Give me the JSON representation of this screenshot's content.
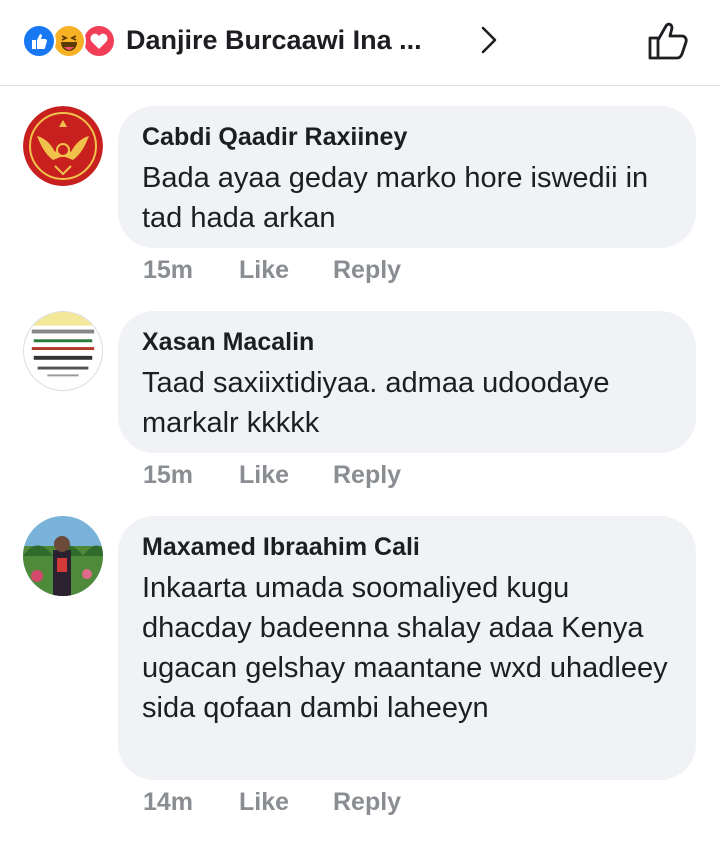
{
  "header": {
    "title": "Danjire Burcaawi Ina ...",
    "reaction_icons": [
      "like-icon",
      "haha-icon",
      "love-icon"
    ],
    "colors": {
      "like": "#1877f2",
      "haha": "#f7b125",
      "love": "#f33e58"
    }
  },
  "comments": [
    {
      "author": "Cabdi Qaadir Raxiiney",
      "text": "Bada ayaa geday marko hore iswedii in tad hada arkan",
      "time": "15m",
      "like_label": "Like",
      "reply_label": "Reply"
    },
    {
      "author": "Xasan Macalin",
      "text": "Taad saxiixtidiyaa. admaa udoodaye markalr kkkkk",
      "time": "15m",
      "like_label": "Like",
      "reply_label": "Reply"
    },
    {
      "author": "Maxamed Ibraahim Cali",
      "text": "Inkaarta umada soomaliyed kugu dhacday badeenna shalay adaa Kenya ugacan gelshay maantane wxd uhadleey sida qofaan dambi laheeyn",
      "time": "14m",
      "like_label": "Like",
      "reply_label": "Reply"
    }
  ]
}
